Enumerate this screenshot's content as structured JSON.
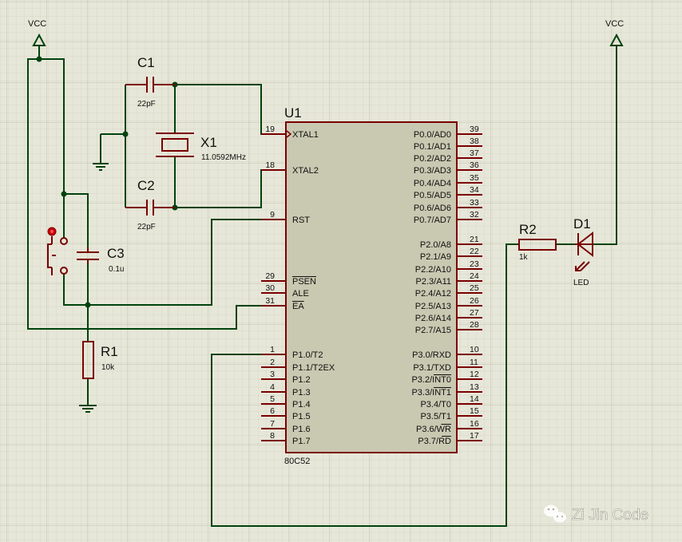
{
  "colors": {
    "background": "#e7e7d9",
    "grid_fine": "#d7d7c8",
    "grid_major": "#c3c3b1",
    "wire": "#00420d",
    "component": "#7a0000",
    "chip_fill": "#c9c8b1",
    "text": "#101010"
  },
  "power": {
    "vcc_left": "VCC",
    "vcc_right": "VCC"
  },
  "components": {
    "c1": {
      "ref": "C1",
      "value": "22pF"
    },
    "c2": {
      "ref": "C2",
      "value": "22pF"
    },
    "c3": {
      "ref": "C3",
      "value": "0.1u"
    },
    "x1": {
      "ref": "X1",
      "value": "11.0592MHz"
    },
    "r1": {
      "ref": "R1",
      "value": "10k"
    },
    "r2": {
      "ref": "R2",
      "value": "1k"
    },
    "d1": {
      "ref": "D1",
      "value": "LED"
    }
  },
  "chip": {
    "ref": "U1",
    "part": "80C52",
    "left_pins": [
      {
        "num": "19",
        "name": "XTAL1"
      },
      {
        "num": "18",
        "name": "XTAL2"
      },
      {
        "num": "9",
        "name": "RST"
      },
      {
        "num": "29",
        "name": "PSEN"
      },
      {
        "num": "30",
        "name": "ALE"
      },
      {
        "num": "31",
        "name": "EA"
      },
      {
        "num": "1",
        "name": "P1.0/T2"
      },
      {
        "num": "2",
        "name": "P1.1/T2EX"
      },
      {
        "num": "3",
        "name": "P1.2"
      },
      {
        "num": "4",
        "name": "P1.3"
      },
      {
        "num": "5",
        "name": "P1.4"
      },
      {
        "num": "6",
        "name": "P1.5"
      },
      {
        "num": "7",
        "name": "P1.6"
      },
      {
        "num": "8",
        "name": "P1.7"
      }
    ],
    "right_pins": [
      {
        "num": "39",
        "name": "P0.0/AD0"
      },
      {
        "num": "38",
        "name": "P0.1/AD1"
      },
      {
        "num": "37",
        "name": "P0.2/AD2"
      },
      {
        "num": "36",
        "name": "P0.3/AD3"
      },
      {
        "num": "35",
        "name": "P0.4/AD4"
      },
      {
        "num": "34",
        "name": "P0.5/AD5"
      },
      {
        "num": "33",
        "name": "P0.6/AD6"
      },
      {
        "num": "32",
        "name": "P0.7/AD7"
      },
      {
        "num": "21",
        "name": "P2.0/A8"
      },
      {
        "num": "22",
        "name": "P2.1/A9"
      },
      {
        "num": "23",
        "name": "P2.2/A10"
      },
      {
        "num": "24",
        "name": "P2.3/A11"
      },
      {
        "num": "25",
        "name": "P2.4/A12"
      },
      {
        "num": "26",
        "name": "P2.5/A13"
      },
      {
        "num": "27",
        "name": "P2.6/A14"
      },
      {
        "num": "28",
        "name": "P2.7/A15"
      },
      {
        "num": "10",
        "name": "P3.0/RXD"
      },
      {
        "num": "11",
        "name": "P3.1/TXD"
      },
      {
        "num": "12",
        "name": "P3.2/INT0"
      },
      {
        "num": "13",
        "name": "P3.3/INT1"
      },
      {
        "num": "14",
        "name": "P3.4/T0"
      },
      {
        "num": "15",
        "name": "P3.5/T1"
      },
      {
        "num": "16",
        "name": "P3.6/WR"
      },
      {
        "num": "17",
        "name": "P3.7/RD"
      }
    ]
  },
  "watermark": {
    "text": "Zi Jin Code"
  }
}
